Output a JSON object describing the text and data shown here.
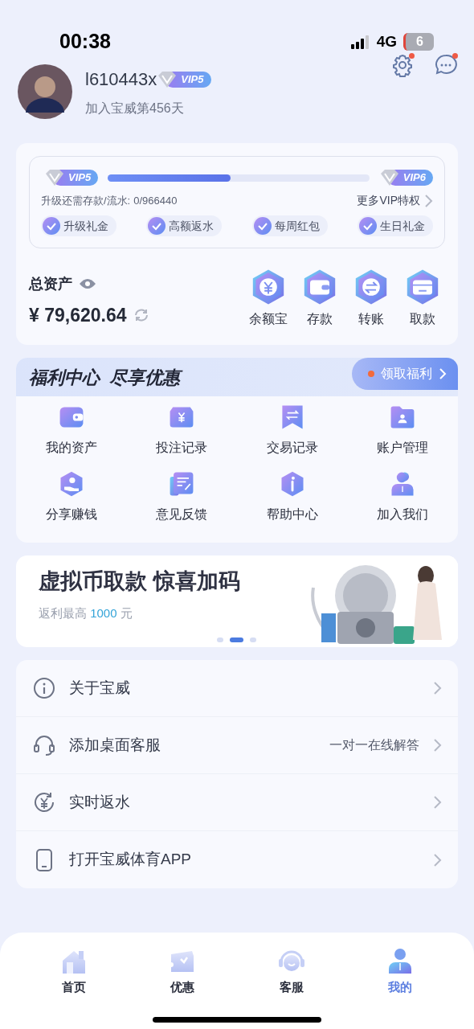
{
  "status_bar": {
    "time": "00:38",
    "network": "4G",
    "battery": "6"
  },
  "profile": {
    "username": "l610443x",
    "vip_badge": "VIP5",
    "joined": "加入宝威第456天",
    "settings_badge": true,
    "messages_badge": true
  },
  "vip": {
    "current": "VIP5",
    "next": "VIP6",
    "level": 0.47,
    "requirement_label": "升级还需存款/流水:",
    "requirement_value": "0/966440",
    "more_link": "更多VIP特权",
    "perks": [
      {
        "label": "升级礼金",
        "checked": true
      },
      {
        "label": "高额返水",
        "checked": true
      },
      {
        "label": "每周红包",
        "checked": true
      },
      {
        "label": "生日礼金",
        "checked": true
      }
    ]
  },
  "assets": {
    "label": "总资产",
    "amount": "¥ 79,620.64",
    "actions": [
      {
        "label": "余额宝",
        "kind": "yen"
      },
      {
        "label": "存款",
        "kind": "wallet"
      },
      {
        "label": "转账",
        "kind": "transfer"
      },
      {
        "label": "取款",
        "kind": "card"
      }
    ]
  },
  "welfare": {
    "title": "福利中心  尽享优惠",
    "claim_button": "领取福利",
    "items": [
      {
        "label": "我的资产",
        "kind": "wallet"
      },
      {
        "label": "投注记录",
        "kind": "yen-box"
      },
      {
        "label": "交易记录",
        "kind": "bookmark"
      },
      {
        "label": "账户管理",
        "kind": "folder"
      },
      {
        "label": "分享赚钱",
        "kind": "share"
      },
      {
        "label": "意见反馈",
        "kind": "edit"
      },
      {
        "label": "帮助中心",
        "kind": "info"
      },
      {
        "label": "加入我们",
        "kind": "person"
      }
    ]
  },
  "banner": {
    "title": "虚拟币取款 惊喜加码",
    "subtitle": "返利最高",
    "amount": "1000",
    "unit": "元",
    "dots": [
      {
        "selected": false
      },
      {
        "selected": true
      },
      {
        "selected": false
      }
    ]
  },
  "menu": [
    {
      "label": "关于宝威",
      "kind": "info"
    },
    {
      "label": "添加桌面客服",
      "detail": "一对一在线解答",
      "kind": "headset"
    },
    {
      "label": "实时返水",
      "kind": "rebate"
    },
    {
      "label": "打开宝威体育APP",
      "kind": "phone"
    }
  ],
  "tab_bar": [
    {
      "label": "首页",
      "kind": "home",
      "selected": false
    },
    {
      "label": "优惠",
      "kind": "ticket",
      "selected": false
    },
    {
      "label": "客服",
      "kind": "headset",
      "selected": false
    },
    {
      "label": "我的",
      "kind": "person",
      "selected": true
    }
  ]
}
